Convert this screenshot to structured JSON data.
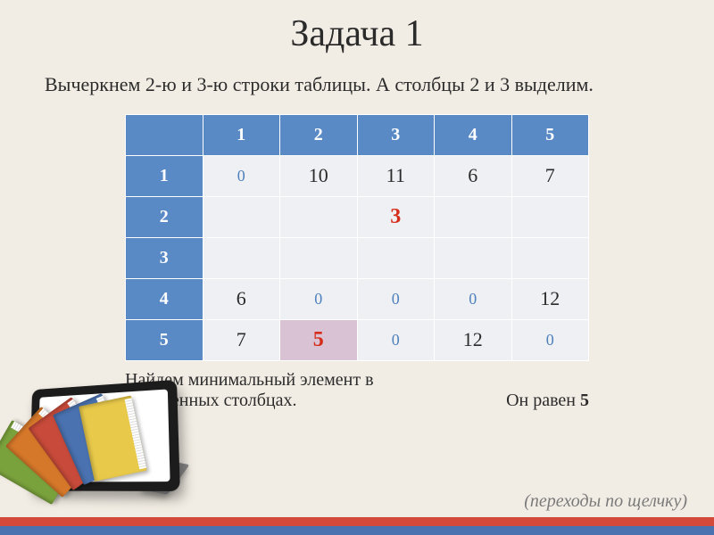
{
  "title": "Задача 1",
  "subtitle": "Вычеркнем 2-ю и 3-ю строки таблицы. А столбцы 2 и 3 выделим.",
  "chart_data": {
    "type": "table",
    "col_headers": [
      "1",
      "2",
      "3",
      "4",
      "5"
    ],
    "row_headers": [
      "1",
      "2",
      "3",
      "4",
      "5"
    ],
    "cells": [
      [
        "0",
        "10",
        "11",
        "6",
        "7"
      ],
      [
        "",
        "",
        "3",
        "",
        ""
      ],
      [
        "",
        "",
        "",
        "",
        ""
      ],
      [
        "6",
        "0",
        "0",
        "0",
        "12"
      ],
      [
        "7",
        "5",
        "0",
        "12",
        "0"
      ]
    ],
    "zero_cells": [
      [
        0,
        0
      ],
      [
        3,
        1
      ],
      [
        3,
        2
      ],
      [
        3,
        3
      ],
      [
        4,
        2
      ],
      [
        4,
        4
      ]
    ],
    "red_cells": [
      [
        1,
        2
      ]
    ],
    "red_highlight_cells": [
      [
        4,
        1
      ]
    ]
  },
  "caption_line1": "Найдем минимальный элемент в",
  "caption_line2_left": "выделенных столбцах.",
  "caption_answer_prefix": "Он равен ",
  "caption_answer_value": "5",
  "footer_note": "(переходы по щелчку)",
  "colors": {
    "header_bg": "#5a8ac6",
    "cell_bg": "#eef0f3",
    "zero_color": "#4f81bd",
    "red_color": "#d62c1a",
    "page_bg": "#f2ede4"
  }
}
